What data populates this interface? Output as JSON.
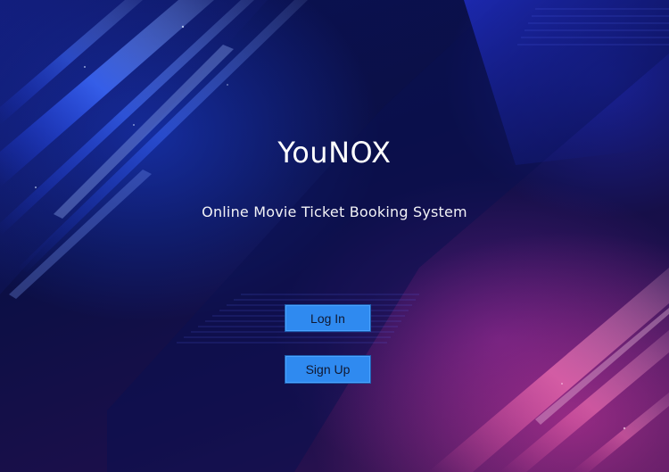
{
  "app": {
    "title": "YouNOX",
    "subtitle": "Online Movie Ticket Booking System"
  },
  "buttons": {
    "login_label": "Log In",
    "signup_label": "Sign Up"
  },
  "colors": {
    "button_fill": "#2f8af0",
    "background_dark": "#0a0f3a",
    "accent_blue": "#1e46e6",
    "accent_pink": "#dc3ca0"
  }
}
